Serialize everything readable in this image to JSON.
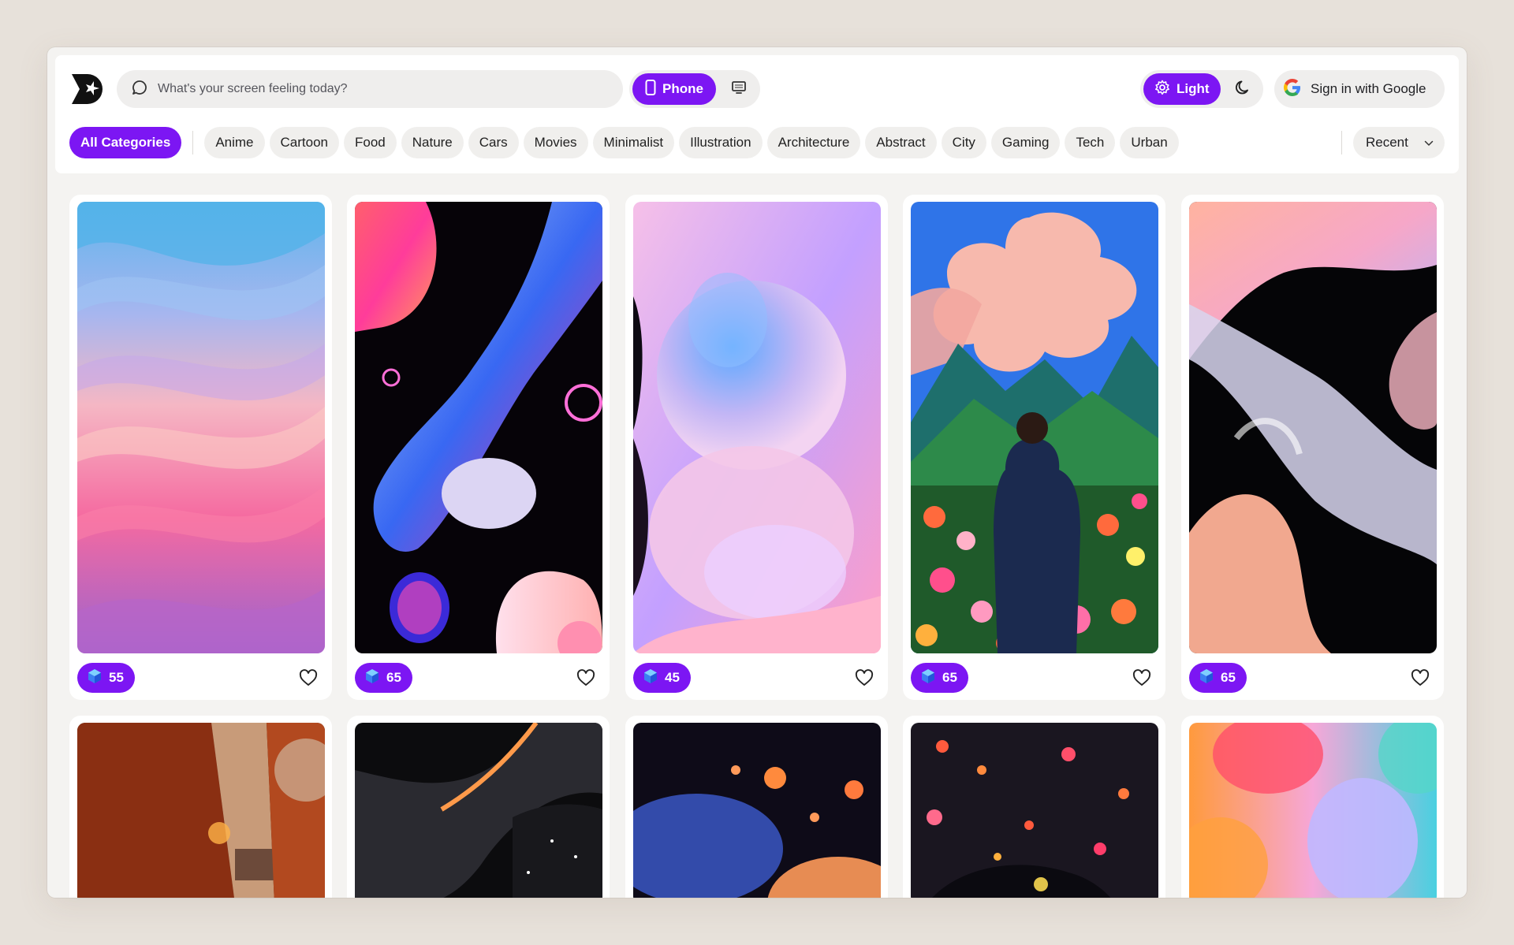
{
  "header": {
    "logo_icon": "brand-logo-icon",
    "search": {
      "placeholder": "What's your screen feeling today?",
      "icon": "chat-bubble-icon"
    },
    "device_toggle": {
      "active_label": "Phone",
      "active_icon": "phone-icon",
      "other_icon": "desktop-icon"
    },
    "theme_toggle": {
      "active_label": "Light",
      "active_icon": "gear-icon",
      "other_icon": "moon-icon"
    },
    "sign_in": {
      "label": "Sign in with Google",
      "icon": "google-icon"
    }
  },
  "categories": {
    "active": "All Categories",
    "items": [
      "Anime",
      "Cartoon",
      "Food",
      "Nature",
      "Cars",
      "Movies",
      "Minimalist",
      "Illustration",
      "Architecture",
      "Abstract",
      "City",
      "Gaming",
      "Tech",
      "Urban"
    ]
  },
  "sort": {
    "value": "Recent"
  },
  "accent_color": "#7c16f3",
  "wallpapers": [
    {
      "count": "55",
      "gem_icon": "gem-icon",
      "like_icon": "heart-icon"
    },
    {
      "count": "65",
      "gem_icon": "gem-icon",
      "like_icon": "heart-icon"
    },
    {
      "count": "45",
      "gem_icon": "gem-icon",
      "like_icon": "heart-icon"
    },
    {
      "count": "65",
      "gem_icon": "gem-icon",
      "like_icon": "heart-icon"
    },
    {
      "count": "65",
      "gem_icon": "gem-icon",
      "like_icon": "heart-icon"
    }
  ]
}
